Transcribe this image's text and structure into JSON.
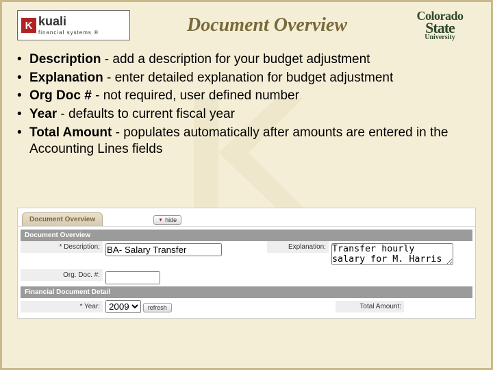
{
  "header": {
    "logo_left": {
      "brand": "kuali",
      "sub": "financial systems"
    },
    "title": "Document Overview",
    "logo_right": {
      "l1": "Colorado",
      "l2": "State",
      "l3": "University"
    }
  },
  "bullets": [
    {
      "label": "Description",
      "text": " - add a description for your budget adjustment"
    },
    {
      "label": "Explanation",
      "text": " - enter detailed explanation for budget adjustment"
    },
    {
      "label": "Org Doc #",
      "text": " - not required, user defined number"
    },
    {
      "label": "Year",
      "text": " - defaults to current fiscal year"
    },
    {
      "label": "Total Amount",
      "text": " - populates automatically after amounts are entered in the Accounting Lines fields"
    }
  ],
  "panel": {
    "tab": "Document Overview",
    "hide": "hide",
    "section1": "Document Overview",
    "desc_label": "* Description:",
    "desc_value": "BA- Salary Transfer",
    "expl_label": "Explanation:",
    "expl_value": "Transfer hourly salary for M. Harris from Provost to Office of Budgets.",
    "orgdoc_label": "Org. Doc. #:",
    "orgdoc_value": "",
    "section2": "Financial Document Detail",
    "year_label": "* Year:",
    "year_value": "2009",
    "refresh": "refresh",
    "total_label": "Total Amount:",
    "total_value": ""
  }
}
